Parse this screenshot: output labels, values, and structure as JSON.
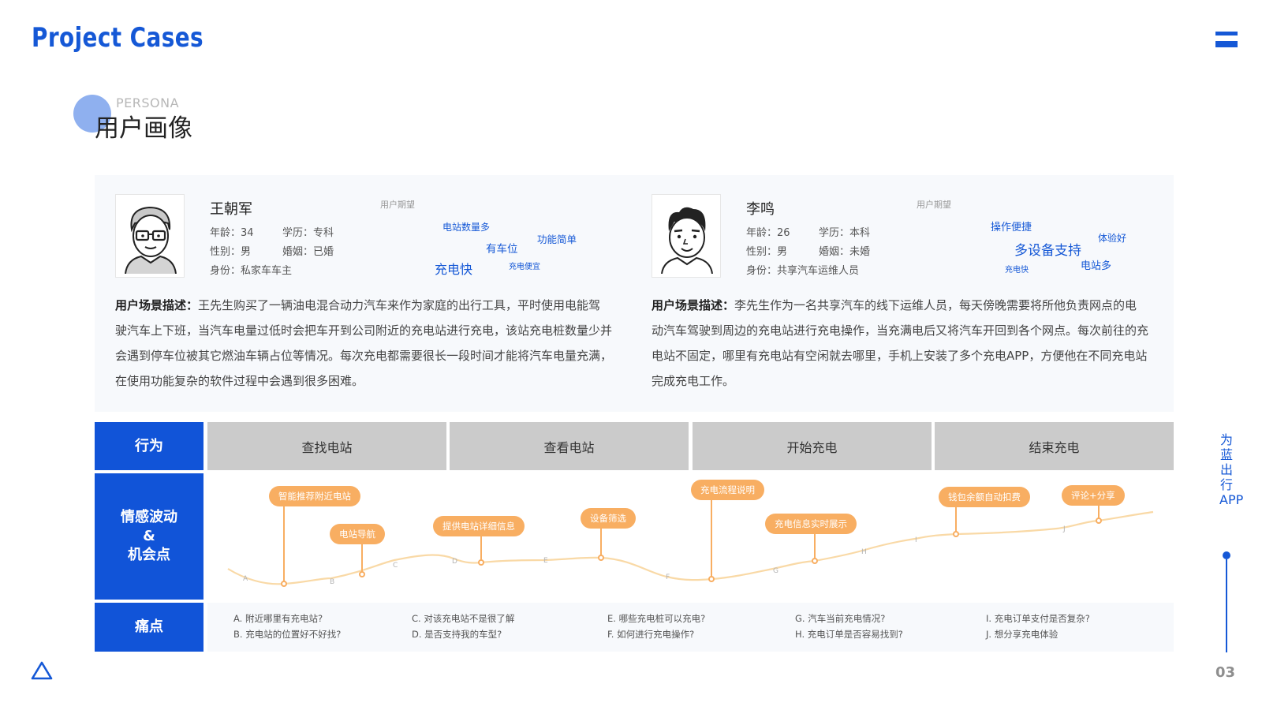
{
  "header": {
    "title": "Project Cases"
  },
  "section": {
    "en": "PERSONA",
    "cn": "用户画像"
  },
  "personas": [
    {
      "name": "王朝军",
      "age": "年龄：34",
      "edu": "学历：专科",
      "gender": "性别：男",
      "marriage": "婚姻：已婚",
      "identity": "身份：私家车车主",
      "expect_label": "用户期望",
      "tags": [
        "电站数量多",
        "功能简单",
        "有车位",
        "充电快",
        "充电便宜"
      ],
      "desc_label": "用户场景描述：",
      "desc": "王先生购买了一辆油电混合动力汽车来作为家庭的出行工具，平时使用电能驾驶汽车上下班，当汽车电量过低时会把车开到公司附近的充电站进行充电，该站充电桩数量少并会遇到停车位被其它燃油车辆占位等情况。每次充电都需要很长一段时间才能将汽车电量充满，在使用功能复杂的软件过程中会遇到很多困难。"
    },
    {
      "name": "李鸣",
      "age": "年龄：26",
      "edu": "学历：本科",
      "gender": "性别：男",
      "marriage": "婚姻：未婚",
      "identity": "身份：共享汽车运维人员",
      "expect_label": "用户期望",
      "tags": [
        "操作便捷",
        "体验好",
        "多设备支持",
        "电站多",
        "充电快"
      ],
      "desc_label": "用户场景描述：",
      "desc": "李先生作为一名共享汽车的线下运维人员，每天傍晚需要将所他负责网点的电动汽车驾驶到周边的充电站进行充电操作，当充满电后又将汽车开回到各个网点。每次前往的充电站不固定，哪里有充电站有空闲就去哪里，手机上安装了多个充电APP，方便他在不同充电站完成充电工作。"
    }
  ],
  "journey": {
    "row_labels": {
      "behavior": "行为",
      "emotion": "情感波动\n&\n机会点",
      "pain": "痛点"
    },
    "stages": [
      "查找电站",
      "查看电站",
      "开始充电",
      "结束充电"
    ],
    "curve_points": [
      "A",
      "B",
      "C",
      "D",
      "E",
      "F",
      "G",
      "H",
      "I",
      "J"
    ],
    "opportunities": [
      "智能推荐附近电站",
      "电站导航",
      "提供电站详细信息",
      "设备筛选",
      "充电流程说明",
      "充电信息实时展示",
      "钱包余额自动扣费",
      "评论+分享"
    ],
    "pain_points": [
      "A. 附近哪里有充电站?",
      "B. 充电站的位置好不好找?",
      "C. 对该充电站不是很了解",
      "D. 是否支持我的车型?",
      "E. 哪些充电桩可以充电?",
      "F. 如何进行充电操作?",
      "G. 汽车当前充电情况?",
      "H. 充电订单是否容易找到?",
      "I. 充电订单支付是否复杂?",
      "J. 想分享充电体验"
    ]
  },
  "side": {
    "vertical": "为蓝出行APP",
    "page": "03"
  },
  "colors": {
    "primary": "#1154d8",
    "accent": "#f8ae62",
    "curve": "#f9d9a6",
    "stage_bg": "#cbcbcb"
  }
}
